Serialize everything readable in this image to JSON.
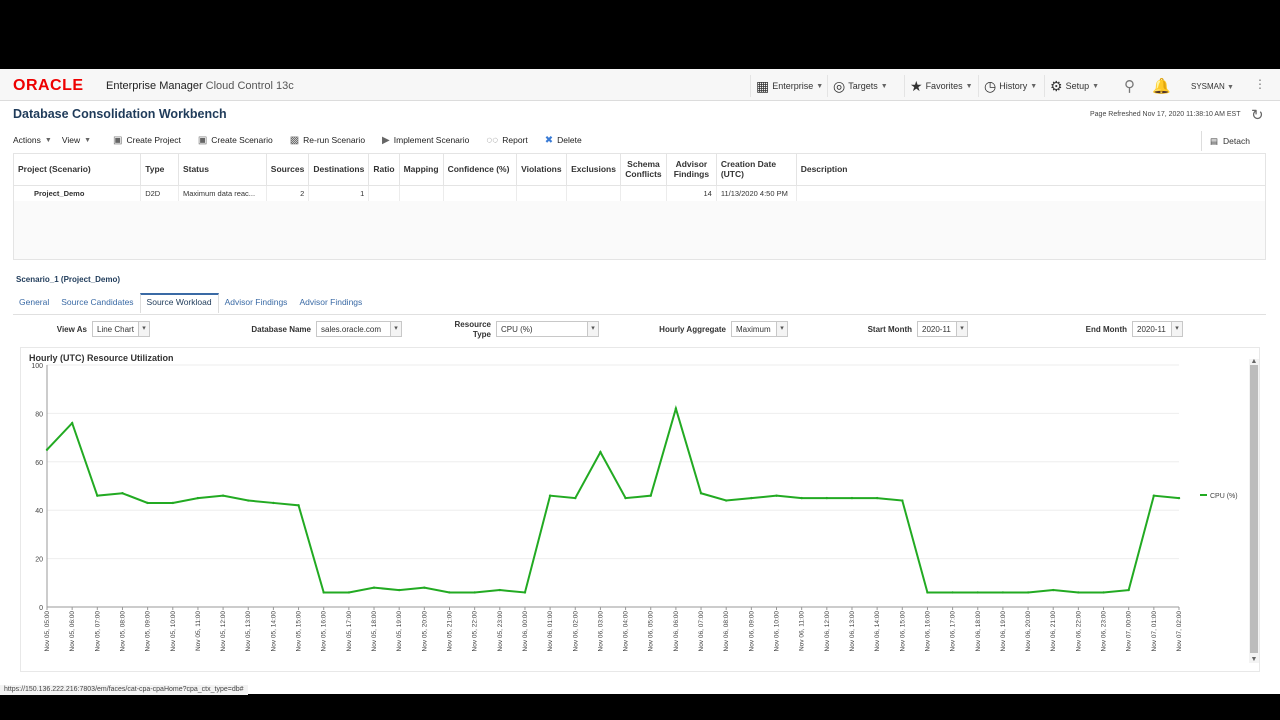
{
  "header": {
    "logo": "ORACLE",
    "product_bold": "Enterprise Manager",
    "product_thin": "Cloud Control 13c",
    "menus": [
      {
        "label": "Enterprise",
        "icon": "building-icon"
      },
      {
        "label": "Targets",
        "icon": "target-icon"
      },
      {
        "label": "Favorites",
        "icon": "star-icon"
      },
      {
        "label": "History",
        "icon": "clock-icon"
      },
      {
        "label": "Setup",
        "icon": "gear-icon"
      }
    ],
    "user": "SYSMAN"
  },
  "page": {
    "title": "Database Consolidation Workbench",
    "refreshed": "Page Refreshed Nov 17, 2020 11:38:10 AM EST"
  },
  "toolbar": {
    "actions": "Actions",
    "view": "View",
    "create_project": "Create Project",
    "create_scenario": "Create Scenario",
    "rerun_scenario": "Re-run Scenario",
    "implement_scenario": "Implement Scenario",
    "report": "Report",
    "delete": "Delete",
    "detach": "Detach"
  },
  "table": {
    "headers": [
      "Project (Scenario)",
      "Type",
      "Status",
      "Sources",
      "Destinations",
      "Ratio",
      "Mapping",
      "Confidence (%)",
      "Violations",
      "Exclusions",
      "Schema Conflicts",
      "Advisor Findings",
      "Creation Date (UTC)",
      "Description"
    ],
    "rows": [
      [
        "Project_Demo",
        "D2D",
        "Maximum data reac...",
        "2",
        "1",
        "",
        "",
        "",
        "",
        "",
        "",
        "14",
        "11/13/2020 4:50 PM",
        ""
      ]
    ]
  },
  "scenario": {
    "title": "Scenario_1 (Project_Demo)",
    "tabs": [
      "General",
      "Source Candidates",
      "Source Workload",
      "Advisor Findings",
      "Advisor Findings"
    ],
    "active_tab": "Source Workload"
  },
  "filters": {
    "view_as_label": "View As",
    "view_as": "Line Chart",
    "db_label": "Database Name",
    "db": "sales.oracle.com",
    "resource_label_1": "Resource",
    "resource_label_2": "Type",
    "resource": "CPU (%)",
    "hourly_label": "Hourly Aggregate",
    "hourly": "Maximum",
    "start_label": "Start Month",
    "start": "2020-11",
    "end_label": "End Month",
    "end": "2020-11"
  },
  "status_url": "https://150.136.222.216:7803/em/faces/cat-cpa-cpaHome?cpa_ctx_type=db#",
  "chart_data": {
    "type": "line",
    "title": "Hourly (UTC) Resource Utilization",
    "ylim": [
      0,
      100
    ],
    "yticks": [
      0,
      20,
      40,
      60,
      80,
      100
    ],
    "grid": true,
    "legend_position": "right",
    "color": "#22aa22",
    "x": [
      "Nov 05, 05:00",
      "Nov 05, 06:00",
      "Nov 05, 07:00",
      "Nov 05, 08:00",
      "Nov 05, 09:00",
      "Nov 05, 10:00",
      "Nov 05, 11:00",
      "Nov 05, 12:00",
      "Nov 05, 13:00",
      "Nov 05, 14:00",
      "Nov 05, 15:00",
      "Nov 05, 16:00",
      "Nov 05, 17:00",
      "Nov 05, 18:00",
      "Nov 05, 19:00",
      "Nov 05, 20:00",
      "Nov 05, 21:00",
      "Nov 05, 22:00",
      "Nov 05, 23:00",
      "Nov 06, 00:00",
      "Nov 06, 01:00",
      "Nov 06, 02:00",
      "Nov 06, 03:00",
      "Nov 06, 04:00",
      "Nov 06, 05:00",
      "Nov 06, 06:00",
      "Nov 06, 07:00",
      "Nov 06, 08:00",
      "Nov 06, 09:00",
      "Nov 06, 10:00",
      "Nov 06, 11:00",
      "Nov 06, 12:00",
      "Nov 06, 13:00",
      "Nov 06, 14:00",
      "Nov 06, 15:00",
      "Nov 06, 16:00",
      "Nov 06, 17:00",
      "Nov 06, 18:00",
      "Nov 06, 19:00",
      "Nov 06, 20:00",
      "Nov 06, 21:00",
      "Nov 06, 22:00",
      "Nov 06, 23:00",
      "Nov 07, 00:00",
      "Nov 07, 01:00",
      "Nov 07, 02:00"
    ],
    "series": [
      {
        "name": "CPU (%)",
        "values": [
          65,
          76,
          46,
          47,
          43,
          43,
          45,
          46,
          44,
          43,
          42,
          6,
          6,
          8,
          7,
          8,
          6,
          6,
          7,
          6,
          46,
          45,
          64,
          45,
          46,
          82,
          47,
          44,
          45,
          46,
          45,
          45,
          45,
          45,
          44,
          6,
          6,
          6,
          6,
          6,
          7,
          6,
          6,
          7,
          46,
          45
        ]
      }
    ]
  }
}
